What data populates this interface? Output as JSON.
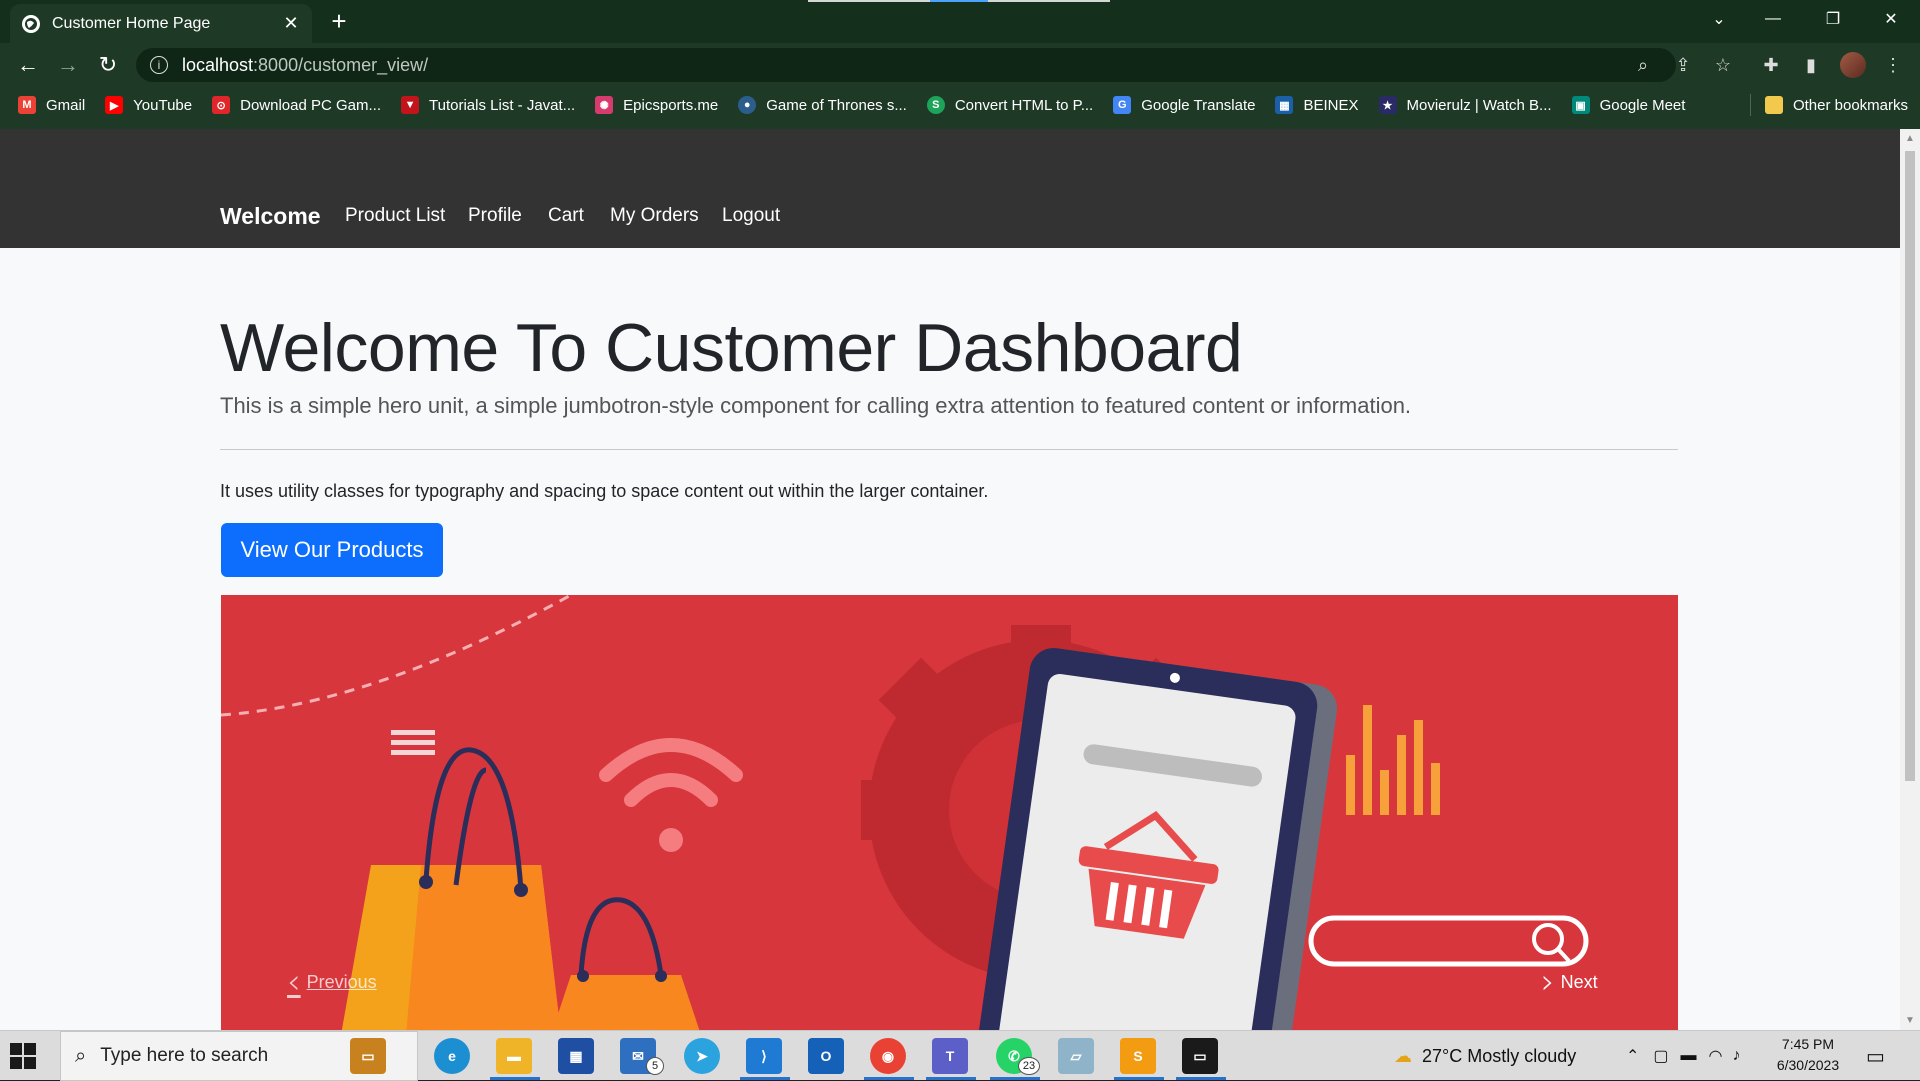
{
  "browser": {
    "tab_title": "Customer Home Page",
    "tab_close": "✕",
    "new_tab": "+",
    "url_host": "localhost",
    "url_path": ":8000/customer_view/",
    "window_controls": [
      "⌄",
      "—",
      "❐",
      "✕"
    ]
  },
  "bookmarks": [
    {
      "label": "Gmail",
      "icon": "gmail-icon",
      "color": "#ea4335"
    },
    {
      "label": "YouTube",
      "icon": "youtube-icon",
      "color": "#ff0000"
    },
    {
      "label": "Download PC Gam...",
      "icon": "download-icon",
      "color": "#e0262b"
    },
    {
      "label": "Tutorials List - Javat...",
      "icon": "javatpoint-icon",
      "color": "#c4141b"
    },
    {
      "label": "Epicsports.me",
      "icon": "epicsports-icon",
      "color": "#d63a6e"
    },
    {
      "label": "Game of Thrones s...",
      "icon": "got-icon",
      "color": "#2b5e8c"
    },
    {
      "label": "Convert HTML to P...",
      "icon": "convert-icon",
      "color": "#1ea35a"
    },
    {
      "label": "Google Translate",
      "icon": "translate-icon",
      "color": "#4285f4"
    },
    {
      "label": "BEINEX",
      "icon": "beinex-icon",
      "color": "#1b5fa8"
    },
    {
      "label": "Movierulz | Watch B...",
      "icon": "movierulz-icon",
      "color": "#2a2a66"
    },
    {
      "label": "Google Meet",
      "icon": "meet-icon",
      "color": "#00897b"
    }
  ],
  "other_bookmarks": "Other bookmarks",
  "navbar": {
    "brand": "Welcome",
    "links": [
      "Product List",
      "Profile",
      "Cart",
      "My Orders",
      "Logout"
    ]
  },
  "hero": {
    "title": "Welcome To Customer Dashboard",
    "lead": "This is a simple hero unit, a simple jumbotron-style component for calling extra attention to featured content or information.",
    "text": "It uses utility classes for typography and spacing to space content out within the larger container.",
    "button": "View Our Products"
  },
  "carousel": {
    "prev": "Previous",
    "next": "Next"
  },
  "taskbar": {
    "search_placeholder": "Type here to search",
    "mail_badge": "5",
    "whatsapp_badge": "23",
    "weather": "27°C  Mostly cloudy",
    "time": "7:45 PM",
    "date": "6/30/2023"
  },
  "colors": {
    "navbar_bg": "#333333",
    "primary": "#0d6efd",
    "carousel_bg": "#d8363d"
  }
}
